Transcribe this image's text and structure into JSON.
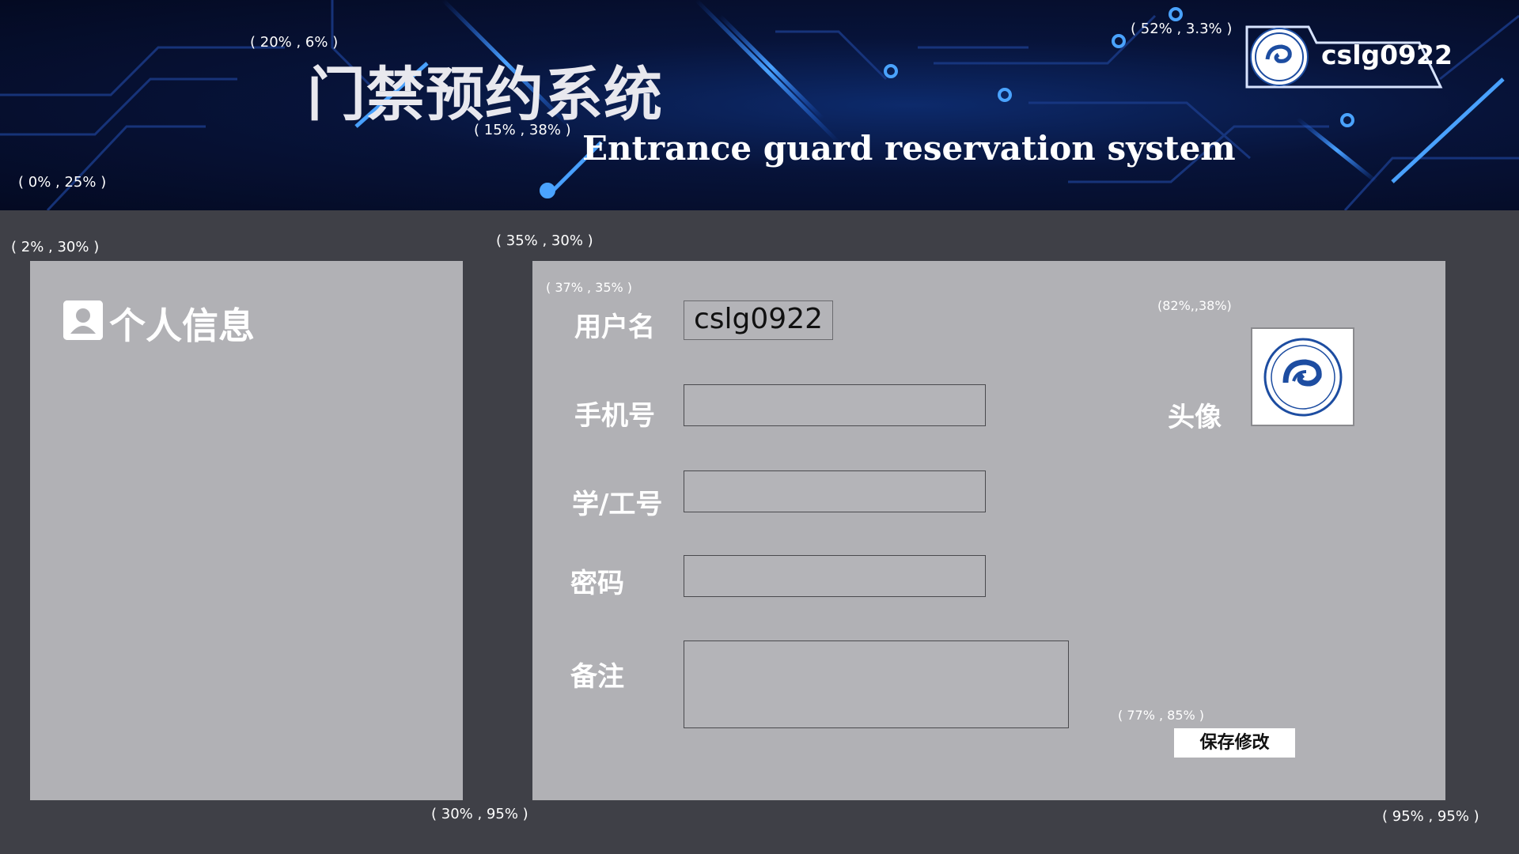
{
  "header": {
    "title_cn": "门禁预约系统",
    "title_en": "Entrance guard reservation system",
    "username": "cslg0922",
    "logo_icon": "school-logo-icon"
  },
  "annotations": {
    "title_pos": "( 20% , 6% )",
    "subtitle_pos": "( 15% , 38% )",
    "header_height": "( 0% , 25% )",
    "badge_pos": "( 52% , 3.3% )",
    "left_panel_pos": "( 2% , 30% )",
    "right_panel_pos": "( 35% , 30% )",
    "form_pos": "( 37% , 35% )",
    "avatar_pos": "(82%,,38%)",
    "save_pos": "( 77% , 85% )",
    "left_panel_end": "( 30% , 95% )",
    "right_panel_end": "( 95% , 95% )"
  },
  "sidebar": {
    "title": "个人信息",
    "icon": "user-profile-icon"
  },
  "form": {
    "username_label": "用户名",
    "username_value": "cslg0922",
    "phone_label": "手机号",
    "phone_value": "",
    "id_label": "学/工号",
    "id_value": "",
    "password_label": "密码",
    "password_value": "",
    "remark_label": "备注",
    "remark_value": "",
    "avatar_label": "头像",
    "save_label": "保存修改"
  },
  "colors": {
    "page_bg": "#3f4047",
    "panel_bg": "#b1b1b5",
    "header_bg": "#071339",
    "accent": "#1e6bff"
  }
}
